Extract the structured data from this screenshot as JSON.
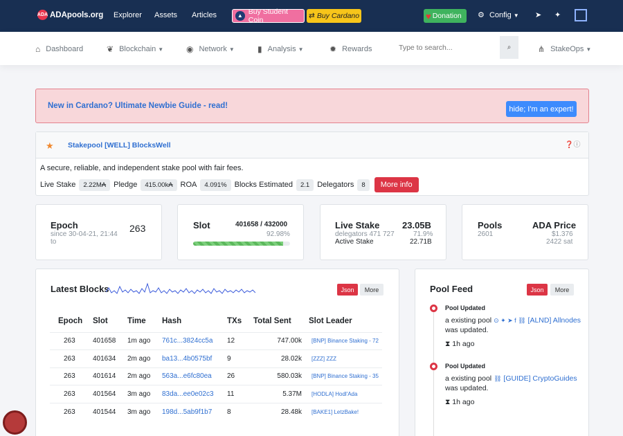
{
  "topbar": {
    "logo_badge": "ADA",
    "logo_text": "ADApools.org",
    "nav": [
      "Explorer",
      "Assets",
      "Articles"
    ],
    "student_label": "Buy Student Coin",
    "buy_label": "Buy Cardano",
    "donation_label": "Donation",
    "config_label": "Config"
  },
  "secnav": {
    "dashboard": "Dashboard",
    "blockchain": "Blockchain",
    "network": "Network",
    "analysis": "Analysis",
    "rewards": "Rewards",
    "search_placeholder": "Type to search...",
    "stakeops": "StakeOps"
  },
  "alert": {
    "text": "New in Cardano? Ultimate Newbie Guide - read!",
    "button": "hide; I'm an expert!"
  },
  "pool": {
    "name": "Stakepool [WELL] BlocksWell",
    "description": "A secure, reliable, and independent stake pool with fair fees.",
    "live_stake_label": "Live Stake",
    "live_stake": "2.22M₳",
    "pledge_label": "Pledge",
    "pledge": "415.00k₳",
    "roa_label": "ROA",
    "roa": "4.091%",
    "blocks_label": "Blocks Estimated",
    "blocks": "2.1",
    "delegators_label": "Delegators",
    "delegators": "8",
    "more_info": "More info"
  },
  "epoch": {
    "label": "Epoch",
    "since": "since 30-04-21, 21:44",
    "to": "to",
    "value": "263"
  },
  "slot": {
    "label": "Slot",
    "value": "401658 / 432000",
    "pct": "92.98%",
    "progress": 0.9298
  },
  "live_stake": {
    "label": "Live Stake",
    "value": "23.05B",
    "delegators": "delegators 471 727",
    "pct": "71.9%",
    "active_label": "Active Stake",
    "active": "22.71B"
  },
  "pools": {
    "label": "Pools",
    "value": "2601",
    "price_label": "ADA Price",
    "price": "$1.376",
    "sat": "2422 sat"
  },
  "latest_blocks": {
    "title": "Latest Blocks",
    "json": "Json",
    "more": "More",
    "columns": [
      "Epoch",
      "Slot",
      "Time",
      "Hash",
      "TXs",
      "Total Sent",
      "Slot Leader"
    ],
    "rows": [
      {
        "epoch": "263",
        "slot": "401658",
        "time": "1m ago",
        "hash": "761c...3824cc5a",
        "txs": "12",
        "sent": "747.00k",
        "leader": "[BNP] Binance Staking - 72"
      },
      {
        "epoch": "263",
        "slot": "401634",
        "time": "2m ago",
        "hash": "ba13...4b0575bf",
        "txs": "9",
        "sent": "28.02k",
        "leader": "[ZZZ] ZZZ"
      },
      {
        "epoch": "263",
        "slot": "401614",
        "time": "2m ago",
        "hash": "563a...e6fc80ea",
        "txs": "26",
        "sent": "580.03k",
        "leader": "[BNP] Binance Staking - 35"
      },
      {
        "epoch": "263",
        "slot": "401564",
        "time": "3m ago",
        "hash": "83da...ee0e02c3",
        "txs": "11",
        "sent": "5.37M",
        "leader": "[HODLA] Hodl'Ada"
      },
      {
        "epoch": "263",
        "slot": "401544",
        "time": "3m ago",
        "hash": "198d...5ab9f1b7",
        "txs": "8",
        "sent": "28.48k",
        "leader": "[BAKE1] LetzBake!"
      }
    ]
  },
  "pool_feed": {
    "title": "Pool Feed",
    "json": "Json",
    "more": "More",
    "items": [
      {
        "title": "Pool Updated",
        "prefix": "a existing pool",
        "link": "[ALND] Allnodes",
        "suffix": "was updated.",
        "time": "1h ago"
      },
      {
        "title": "Pool Updated",
        "prefix": "a existing pool",
        "link": "[GUIDE] CryptoGuides",
        "suffix": "was updated.",
        "time": "1h ago"
      }
    ]
  },
  "colors": {
    "navy": "#182f52",
    "red": "#dc3545",
    "blue": "#2f6fd1",
    "green": "#3fb35e"
  }
}
